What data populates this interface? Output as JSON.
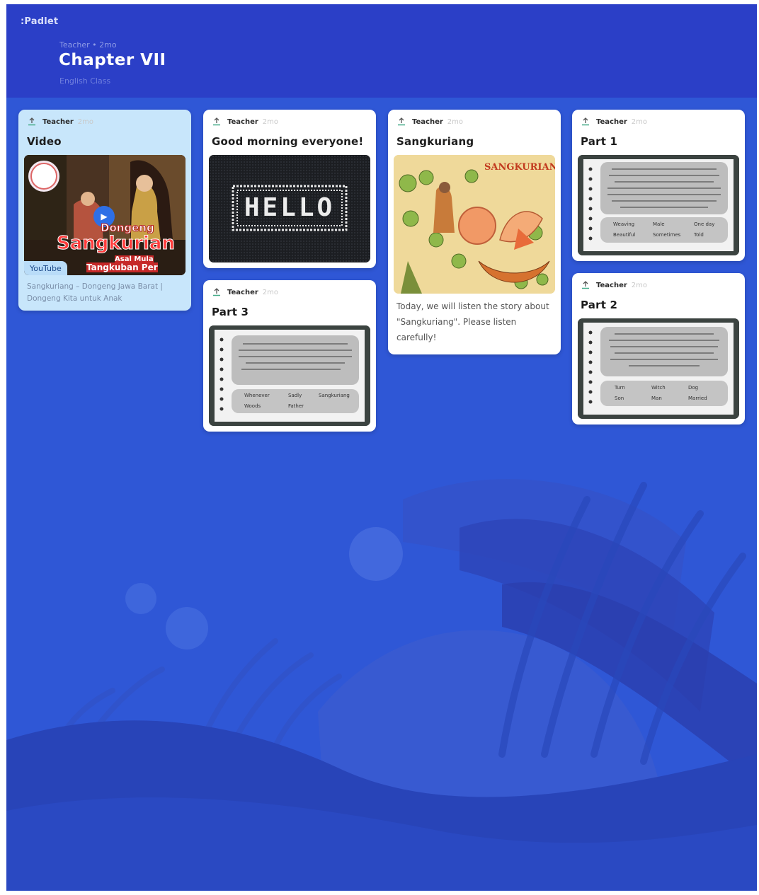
{
  "board": {
    "brand": ":Padlet",
    "meta": "Teacher • 2mo",
    "title": "Chapter VII",
    "subtitle": "English Class"
  },
  "colors": {
    "background": "#2f57d6",
    "header": "#2b3fc7",
    "video_card": "#c8e6fb",
    "card": "#ffffff"
  },
  "posts": [
    {
      "author": "Teacher",
      "time": "2mo",
      "title": "Video",
      "thumbnail_text": [
        "Dongeng",
        "Sangkurian",
        "Asal Mula",
        "Tangkuban Per"
      ],
      "badge": "YouTube",
      "caption": "Sangkuriang – Dongeng Jawa Barat | Dongeng Kita untuk Anak"
    },
    {
      "author": "Teacher",
      "time": "2mo",
      "title": "Good morning everyone!",
      "thumbnail_text": "HELLO"
    },
    {
      "author": "Teacher",
      "time": "2mo",
      "title": "Part 3",
      "worksheet_words": [
        "Whenever",
        "Sadly",
        "Sangkuriang",
        "Woods",
        "Father"
      ]
    },
    {
      "author": "Teacher",
      "time": "2mo",
      "title": "Sangkuriang",
      "thumbnail_text": "SANGKURIANG",
      "body": "Today, we will listen the story about \"Sangkuriang\". Please listen carefully!"
    },
    {
      "author": "Teacher",
      "time": "2mo",
      "title": "Part 1",
      "worksheet_words": [
        "Weaving",
        "Male",
        "One day",
        "Beautiful",
        "Sometimes",
        "Told"
      ]
    },
    {
      "author": "Teacher",
      "time": "2mo",
      "title": "Part 2",
      "worksheet_words": [
        "Turn",
        "Witch",
        "Dog",
        "Son",
        "Man",
        "Married"
      ]
    }
  ],
  "icons": {
    "post_avatar": "upload-icon",
    "video_play": "play-icon"
  }
}
